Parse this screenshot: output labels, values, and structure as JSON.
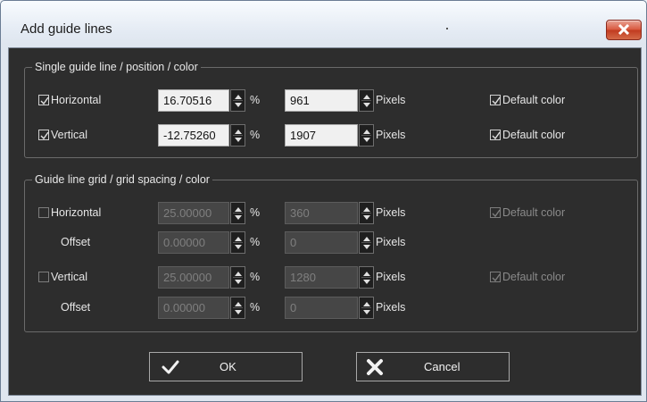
{
  "window": {
    "title": "Add guide lines",
    "close_icon": "close-icon"
  },
  "single": {
    "legend": "Single guide line / position / color",
    "rows": [
      {
        "label": "Horizontal",
        "checked": true,
        "percent_value": "16.70516",
        "percent_unit": "%",
        "pixel_value": "961",
        "pixel_unit": "Pixels",
        "color_label": "Default color",
        "color_checked": true
      },
      {
        "label": "Vertical",
        "checked": true,
        "percent_value": "-12.75260",
        "percent_unit": "%",
        "pixel_value": "1907",
        "pixel_unit": "Pixels",
        "color_label": "Default color",
        "color_checked": true
      }
    ]
  },
  "grid": {
    "legend": "Guide line grid / grid spacing / color",
    "rows": [
      {
        "label": "Horizontal",
        "checked": false,
        "percent_value": "25.00000",
        "percent_unit": "%",
        "pixel_value": "360",
        "pixel_unit": "Pixels",
        "color_label": "Default color",
        "color_checked": true
      },
      {
        "label": "Offset",
        "percent_value": "0.00000",
        "percent_unit": "%",
        "pixel_value": "0",
        "pixel_unit": "Pixels"
      },
      {
        "label": "Vertical",
        "checked": false,
        "percent_value": "25.00000",
        "percent_unit": "%",
        "pixel_value": "1280",
        "pixel_unit": "Pixels",
        "color_label": "Default color",
        "color_checked": true
      },
      {
        "label": "Offset",
        "percent_value": "0.00000",
        "percent_unit": "%",
        "pixel_value": "0",
        "pixel_unit": "Pixels"
      }
    ]
  },
  "buttons": {
    "ok_label": "OK",
    "cancel_label": "Cancel"
  }
}
